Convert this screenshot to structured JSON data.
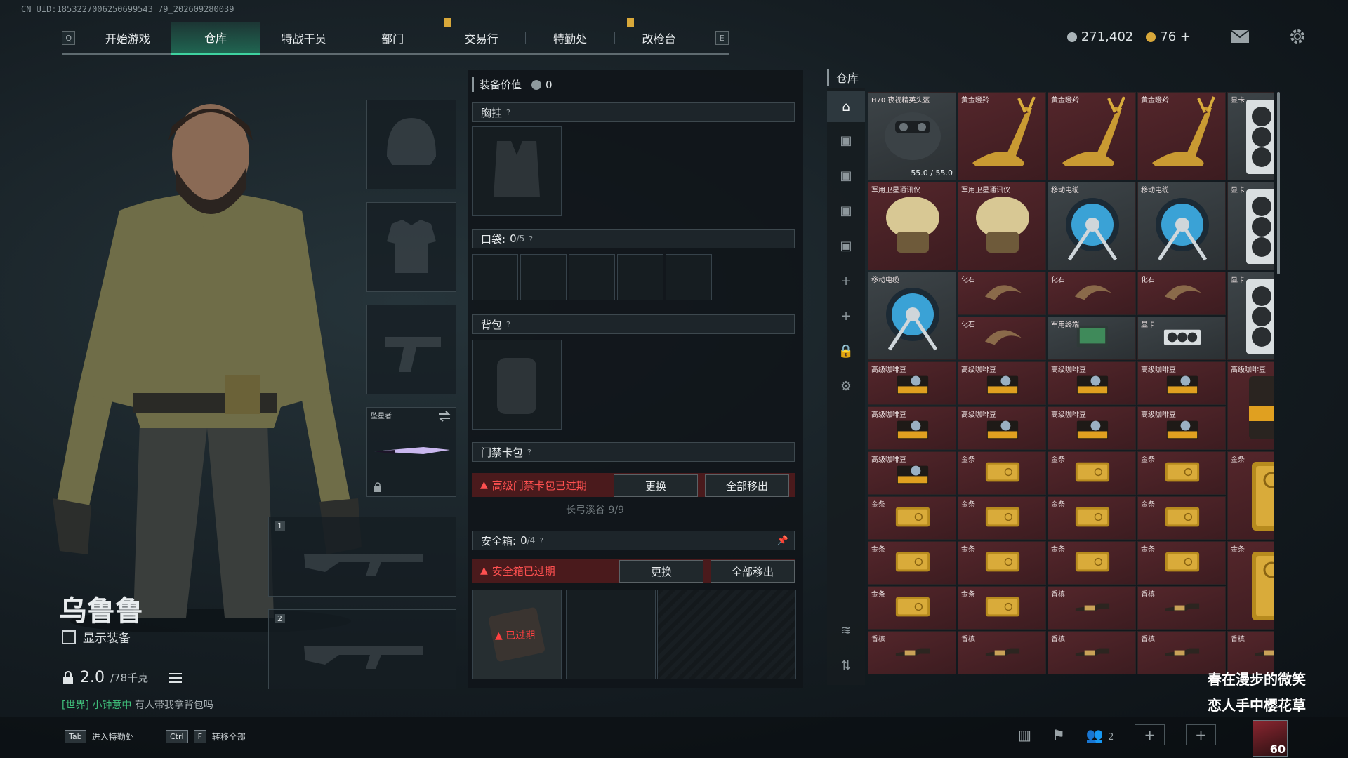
{
  "uid_text": "CN UID:1853227006250699543 79_202609280039",
  "nav": {
    "left_key": "Q",
    "right_key": "E",
    "tabs": [
      "开始游戏",
      "仓库",
      "特战干员",
      "部门",
      "交易行",
      "特勤处",
      "改枪台"
    ],
    "active_index": 1
  },
  "currency": {
    "silver": "271,402",
    "gold": "76",
    "gold_plus": "+"
  },
  "character": {
    "name": "乌鲁鲁",
    "show_gear_label": "显示装备",
    "weight": "2.0",
    "weight_max": "/78千克",
    "chat_channel": "[世界]",
    "chat_user": "小钟意中",
    "chat_message": "有人带我拿背包吗"
  },
  "hotkeys": [
    {
      "keys": [
        "Tab"
      ],
      "label": "进入特勤处"
    },
    {
      "keys": [
        "Ctrl",
        "F"
      ],
      "label": "转移全部"
    }
  ],
  "gear_slots": {
    "melee_name": "坠星者",
    "weapon_slot_1": "1",
    "weapon_slot_2": "2"
  },
  "equipment": {
    "value_label": "装备价值",
    "value": "0",
    "chest_label": "胸挂",
    "pocket_label": "口袋:",
    "pocket_value": "0",
    "pocket_max": "/5",
    "backpack_label": "背包",
    "keycard_label": "门禁卡包",
    "keycard_warning": "高级门禁卡包已过期",
    "keycard_replace": "更换",
    "keycard_remove_all": "全部移出",
    "keycard_sub": "长弓溪谷 9/9",
    "safebox_label": "安全箱:",
    "safebox_value": "0",
    "safebox_max": "/4",
    "safebox_warning": "安全箱已过期",
    "safebox_replace": "更换",
    "safebox_remove_all": "全部移出",
    "safebox_expired_tag": "已过期"
  },
  "warehouse": {
    "title": "仓库",
    "items": [
      {
        "name": "H70 夜视精英头盔",
        "kind": "helmet",
        "dur": "55.0 / 55.0"
      },
      {
        "name": "黄金瞪羚",
        "kind": "gazelle"
      },
      {
        "name": "黄金瞪羚",
        "kind": "gazelle"
      },
      {
        "name": "黄金瞪羚",
        "kind": "gazelle"
      },
      {
        "name": "显卡",
        "kind": "gpuv"
      },
      {
        "name": "军用卫星通讯仪",
        "kind": "dish"
      },
      {
        "name": "军用卫星通讯仪",
        "kind": "dish"
      },
      {
        "name": "移动电缆",
        "kind": "cable"
      },
      {
        "name": "移动电缆",
        "kind": "cable"
      },
      {
        "name": "显卡",
        "kind": "gpuv"
      },
      {
        "name": "移动电缆",
        "kind": "cable"
      },
      {
        "name": "化石",
        "kind": "fossil"
      },
      {
        "name": "化石",
        "kind": "fossil"
      },
      {
        "name": "化石",
        "kind": "fossil"
      },
      {
        "name": "显卡",
        "kind": "gpuv"
      },
      {
        "name": "化石",
        "kind": "fossil"
      },
      {
        "name": "军用终端",
        "kind": "terminal"
      },
      {
        "name": "显卡",
        "kind": "gpuh"
      },
      {
        "name": "高级咖啡豆",
        "kind": "coffee"
      },
      {
        "name": "高级咖啡豆",
        "kind": "coffee"
      },
      {
        "name": "高级咖啡豆",
        "kind": "coffee"
      },
      {
        "name": "高级咖啡豆",
        "kind": "coffee"
      },
      {
        "name": "高级咖啡豆",
        "kind": "coffeebag"
      },
      {
        "name": "高级咖啡豆",
        "kind": "coffee"
      },
      {
        "name": "高级咖啡豆",
        "kind": "coffee"
      },
      {
        "name": "高级咖啡豆",
        "kind": "coffee"
      },
      {
        "name": "高级咖啡豆",
        "kind": "coffee"
      },
      {
        "name": "高级咖啡豆",
        "kind": "coffee"
      },
      {
        "name": "金条",
        "kind": "gold"
      },
      {
        "name": "金条",
        "kind": "gold"
      },
      {
        "name": "金条",
        "kind": "gold"
      },
      {
        "name": "金条",
        "kind": "goldv"
      },
      {
        "name": "金条",
        "kind": "gold"
      },
      {
        "name": "金条",
        "kind": "gold"
      },
      {
        "name": "金条",
        "kind": "gold"
      },
      {
        "name": "金条",
        "kind": "gold"
      },
      {
        "name": "金条",
        "kind": "gold"
      },
      {
        "name": "金条",
        "kind": "gold"
      },
      {
        "name": "金条",
        "kind": "gold"
      },
      {
        "name": "金条",
        "kind": "gold"
      },
      {
        "name": "金条",
        "kind": "goldv"
      },
      {
        "name": "金条",
        "kind": "gold"
      },
      {
        "name": "金条",
        "kind": "gold"
      },
      {
        "name": "香槟",
        "kind": "champagne"
      },
      {
        "name": "香槟",
        "kind": "champagne"
      },
      {
        "name": "香槟",
        "kind": "champagne"
      },
      {
        "name": "香槟",
        "kind": "champagne"
      },
      {
        "name": "香槟",
        "kind": "champagne"
      },
      {
        "name": "香槟",
        "kind": "champagne"
      },
      {
        "name": "香槟",
        "kind": "champagne"
      }
    ]
  },
  "party_count": "2",
  "level": "60",
  "song": {
    "line1": "春在漫步的微笑",
    "line2": "恋人手中樱花草"
  },
  "colors": {
    "accent": "#3fd3a0",
    "warning": "#ff5050",
    "item_red": "#54262b",
    "gold": "#d8a83a"
  }
}
